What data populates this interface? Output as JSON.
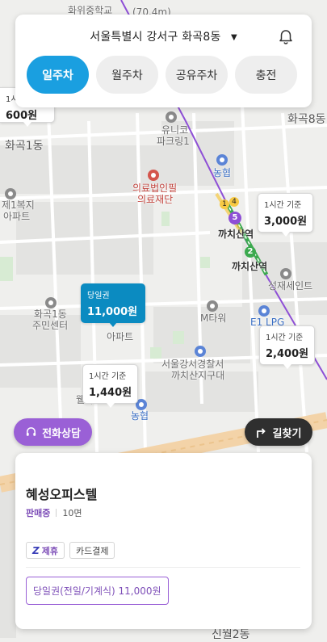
{
  "map": {
    "labels": {
      "school": "화위중학교",
      "distance": "(70.4m)",
      "top_building": "까치산",
      "district_hwagok8": "화곡8동",
      "district_hwagok1": "화곡1동",
      "unico": "유니코",
      "parkring": "파크링1",
      "nonghyup": "농협",
      "uiryo": "의료법인필",
      "uiryo2": "의료재단",
      "jeil1": "제1복지",
      "jeil2": "아파트",
      "station1": "까치산역",
      "station2": "까치산역",
      "seongjae": "성재세인트",
      "hwagok1_center1": "화곡1동",
      "hwagok1_center2": "주민센터",
      "apt_name": "아파트",
      "mtower": "M타워",
      "police1": "서울강서경찰서",
      "police2": "까치산지구대",
      "ellc": "E1 LPG",
      "wella": "웰라",
      "nonghyup2": "농협",
      "sinwol": "신월2동",
      "top_left_partial": "1시",
      "top_left_price": "600원"
    },
    "subway_badges": [
      "1",
      "4",
      "5",
      "2"
    ],
    "markers": [
      {
        "label": "1시간 기준",
        "price": "3,000원",
        "active": false
      },
      {
        "label": "당일권",
        "price": "11,000원",
        "active": true
      },
      {
        "label": "1시간 기준",
        "price": "2,400원",
        "active": false
      },
      {
        "label": "1시간 기준",
        "price": "1,440원",
        "active": false
      }
    ]
  },
  "header": {
    "location": "서울특별시 강서구 화곡8동",
    "bell_icon": "bell-icon"
  },
  "categories": [
    {
      "label": "일주차",
      "active": true
    },
    {
      "label": "월주차",
      "active": false
    },
    {
      "label": "공유주차",
      "active": false
    },
    {
      "label": "충전",
      "active": false
    }
  ],
  "actions": {
    "consult_label": "전화상담",
    "route_label": "길찾기"
  },
  "detail": {
    "name": "혜성오피스텔",
    "status": "판매중",
    "spaces": "10면",
    "tags": [
      {
        "label": "제휴",
        "logo": "Z",
        "partner": true
      },
      {
        "label": "카드결제",
        "partner": false
      }
    ],
    "ticket": "당일권(전일/기계식) 11,000원"
  },
  "colors": {
    "accent": "#1a9fe0",
    "purple": "#9a60d6",
    "marker_active": "#0b8bc1"
  }
}
